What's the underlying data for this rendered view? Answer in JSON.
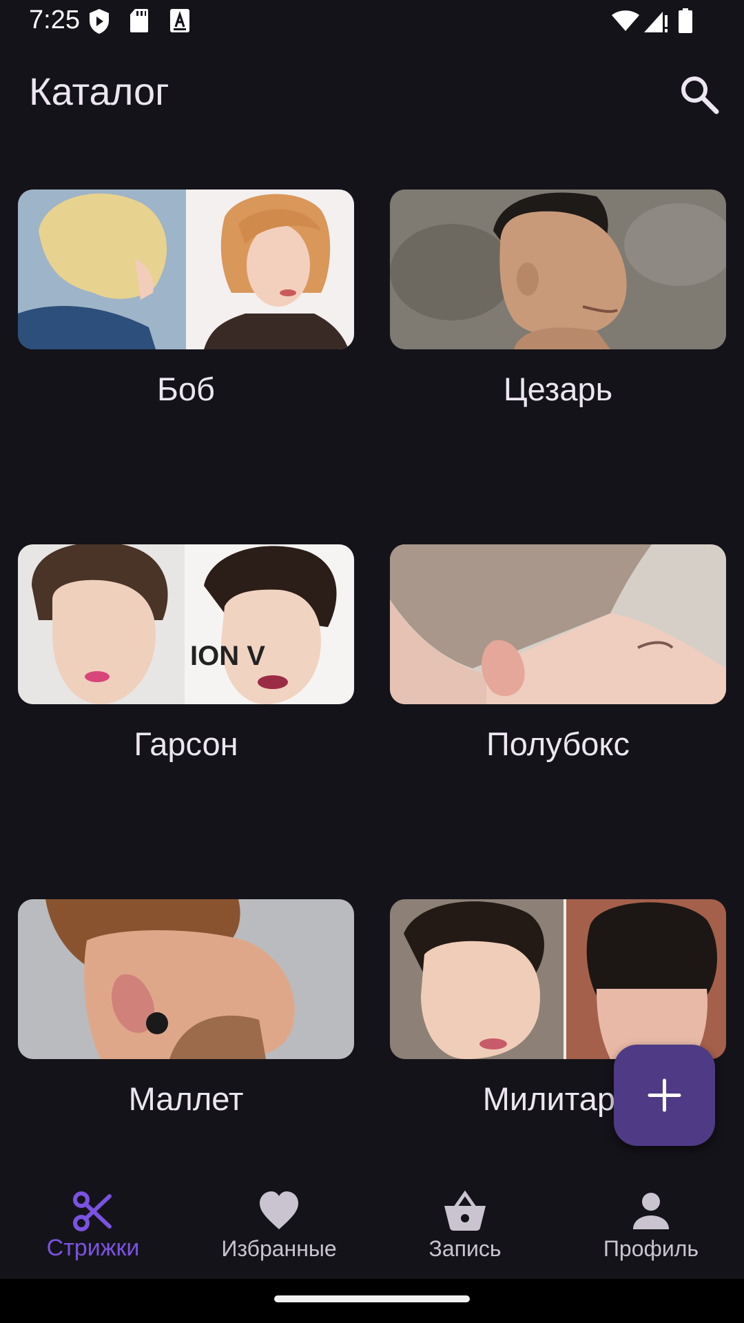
{
  "status_bar": {
    "time": "7:25",
    "icons_left": [
      "shield-play-icon",
      "sd-card-icon",
      "text-a-icon"
    ],
    "icons_right": [
      "wifi-icon",
      "signal-icon",
      "battery-icon"
    ]
  },
  "app_bar": {
    "title": "Каталог",
    "search_icon": "search-icon"
  },
  "catalog": {
    "items": [
      {
        "label": "Боб",
        "image": "bob-haircut-photo"
      },
      {
        "label": "Цезарь",
        "image": "caesar-haircut-photo"
      },
      {
        "label": "Гарсон",
        "image": "garcon-haircut-photo"
      },
      {
        "label": "Полубокс",
        "image": "polubox-haircut-photo"
      },
      {
        "label": "Маллет",
        "image": "mullet-haircut-photo"
      },
      {
        "label": "Милитари",
        "image": "military-haircut-photo"
      }
    ]
  },
  "fab": {
    "icon": "plus-icon",
    "color": "#4f3a86"
  },
  "bottom_nav": {
    "items": [
      {
        "label": "Стрижки",
        "icon": "scissors-icon",
        "active": true
      },
      {
        "label": "Избранные",
        "icon": "heart-icon",
        "active": false
      },
      {
        "label": "Запись",
        "icon": "basket-icon",
        "active": false
      },
      {
        "label": "Профиль",
        "icon": "person-icon",
        "active": false
      }
    ]
  },
  "colors": {
    "background": "#15131a",
    "accent": "#7a53e0",
    "text": "#ece6f0",
    "inactive": "#cac4d0"
  }
}
